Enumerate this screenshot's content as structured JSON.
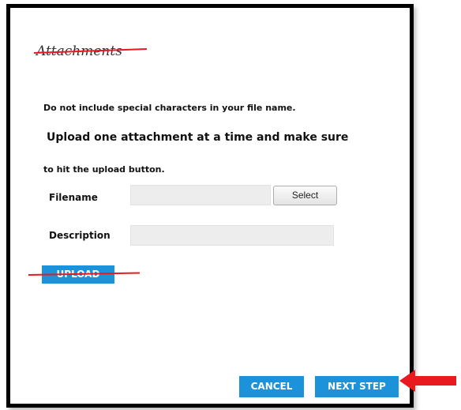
{
  "dialog": {
    "title": "Attachments",
    "instructions": [
      "Do not include special characters in your file name.",
      "Upload one attachment at a time and make sure",
      "to hit the upload button."
    ]
  },
  "form": {
    "filename_label": "Filename",
    "filename_value": "",
    "select_label": "Select",
    "description_label": "Description",
    "description_value": ""
  },
  "buttons": {
    "upload_label": "UPLOAD",
    "cancel_label": "CANCEL",
    "next_step_label": "NEXT STEP"
  },
  "annotations": {
    "strike_color": "#e8191f",
    "arrow_color": "#e8191f",
    "arrow_icon": "arrow-left-icon"
  },
  "colors": {
    "button_blue": "#1b92da",
    "field_gray": "#ededed",
    "dialog_border": "#000000"
  }
}
